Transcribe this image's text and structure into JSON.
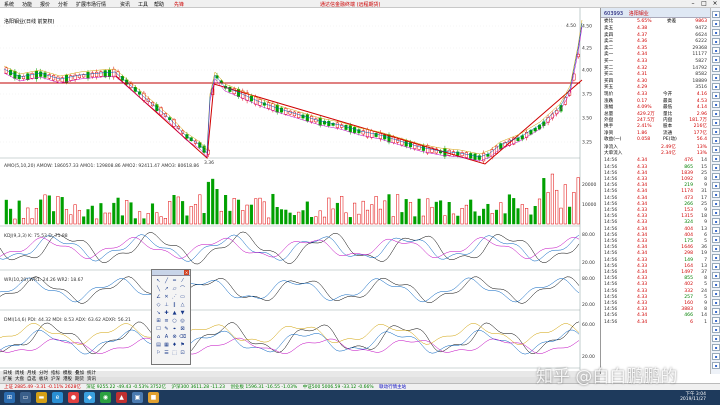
{
  "menu": {
    "items": [
      "系统",
      "功能",
      "报价",
      "分析",
      "扩展市场行情",
      "资讯",
      "工具",
      "帮助"
    ],
    "badge": "先锋",
    "center_title": "通达信金融终端 (远程期货)"
  },
  "stock": {
    "code": "603993",
    "name": "洛阳钼业",
    "chart_title": "洛阳钼业(日线 前复权)",
    "price_top": "4.50",
    "price_low": "3.36"
  },
  "indicators": {
    "amo": "AMO(5,10,20) AMOW: 186057.33  AMO1: 129808.86  AMO2: 92411.47  AMO3: 80618.86",
    "kdj": "KDJ(9,3,3) K: 75.53  D: 71.88",
    "wr": "WR(10,20) WR1: 24.26  WR2: 18.67",
    "dmi": "DMI(14,6) PDI: 44.32  MDI: 8.53  ADX: 63.62  ADXR: 56.21"
  },
  "quote_panel": {
    "header_code": "603993",
    "header_name": "洛阳钼业",
    "weibi": {
      "label": "委比",
      "value": "5.65%",
      "label2": "委差",
      "value2": "9863"
    },
    "asks": [
      {
        "label": "卖五",
        "price": "4.38",
        "vol": "9472"
      },
      {
        "label": "卖四",
        "price": "4.37",
        "vol": "6624"
      },
      {
        "label": "卖三",
        "price": "4.36",
        "vol": "6222"
      },
      {
        "label": "卖二",
        "price": "4.35",
        "vol": "29368"
      },
      {
        "label": "卖一",
        "price": "4.34",
        "vol": "11177"
      }
    ],
    "bids": [
      {
        "label": "买一",
        "price": "4.33",
        "vol": "5827"
      },
      {
        "label": "买二",
        "price": "4.32",
        "vol": "14792"
      },
      {
        "label": "买三",
        "price": "4.31",
        "vol": "8582"
      },
      {
        "label": "买四",
        "price": "4.30",
        "vol": "18889"
      },
      {
        "label": "买五",
        "price": "4.29",
        "vol": "3516"
      }
    ],
    "stats": [
      {
        "l": "现价",
        "v": "4.33",
        "l2": "今开",
        "v2": "4.16"
      },
      {
        "l": "涨跌",
        "v": "0.17",
        "l2": "最高",
        "v2": "4.53"
      },
      {
        "l": "涨幅",
        "v": "4.09%",
        "l2": "最低",
        "v2": "4.14"
      },
      {
        "l": "总量",
        "v": "429.2万",
        "l2": "量比",
        "v2": "2.96"
      },
      {
        "l": "外盘",
        "v": "247.5万",
        "l2": "内盘",
        "v2": "181.7万"
      },
      {
        "l": "换手",
        "v": "2.41%",
        "l2": "股本",
        "v2": "216亿"
      },
      {
        "l": "净资",
        "v": "1.86",
        "l2": "流通",
        "v2": "177亿"
      },
      {
        "l": "收益(一)",
        "v": "0.058",
        "l2": "PE(动)",
        "v2": "56.4"
      }
    ],
    "inflow": [
      {
        "l": "净流入",
        "v": "2.49亿",
        "pct": "13%"
      },
      {
        "l": "大单流入",
        "v": "2.34亿",
        "pct": "13%"
      }
    ],
    "ticks": [
      {
        "t": "14:56",
        "p": "4.34",
        "v": "476",
        "n": "14"
      },
      {
        "t": "14:56",
        "p": "4.33",
        "v": "865",
        "n": "15"
      },
      {
        "t": "14:56",
        "p": "4.34",
        "v": "1839",
        "n": "25"
      },
      {
        "t": "14:56",
        "p": "4.33",
        "v": "1092",
        "n": "8"
      },
      {
        "t": "14:56",
        "p": "4.34",
        "v": "219",
        "n": "9"
      },
      {
        "t": "14:56",
        "p": "4.34",
        "v": "1174",
        "n": "31"
      },
      {
        "t": "14:56",
        "p": "4.34",
        "v": "473",
        "n": "17"
      },
      {
        "t": "14:56",
        "p": "4.34",
        "v": "266",
        "n": "25"
      },
      {
        "t": "14:56",
        "p": "4.33",
        "v": "153",
        "n": "9"
      },
      {
        "t": "14:56",
        "p": "4.33",
        "v": "1315",
        "n": "18"
      },
      {
        "t": "14:56",
        "p": "4.33",
        "v": "324",
        "n": "9"
      },
      {
        "t": "14:56",
        "p": "4.34",
        "v": "404",
        "n": "13"
      },
      {
        "t": "14:56",
        "p": "4.34",
        "v": "404",
        "n": "6"
      },
      {
        "t": "14:56",
        "p": "4.33",
        "v": "175",
        "n": "5"
      },
      {
        "t": "14:56",
        "p": "4.34",
        "v": "1646",
        "n": "36"
      },
      {
        "t": "14:56",
        "p": "4.34",
        "v": "298",
        "n": "19"
      },
      {
        "t": "14:56",
        "p": "4.33",
        "v": "149",
        "n": "7"
      },
      {
        "t": "14:56",
        "p": "4.33",
        "v": "164",
        "n": "13"
      },
      {
        "t": "14:56",
        "p": "4.34",
        "v": "1497",
        "n": "37"
      },
      {
        "t": "14:56",
        "p": "4.33",
        "v": "855",
        "n": "8"
      },
      {
        "t": "14:56",
        "p": "4.33",
        "v": "402",
        "n": "5"
      },
      {
        "t": "14:56",
        "p": "4.33",
        "v": "332",
        "n": "24"
      },
      {
        "t": "14:56",
        "p": "4.33",
        "v": "257",
        "n": "5"
      },
      {
        "t": "14:56",
        "p": "4.33",
        "v": "160",
        "n": "9"
      },
      {
        "t": "14:56",
        "p": "4.33",
        "v": "3883",
        "n": "8"
      },
      {
        "t": "14:56",
        "p": "4.34",
        "v": "466",
        "n": "14"
      },
      {
        "t": "14:56",
        "p": "4.34",
        "v": "6",
        "n": "1"
      }
    ]
  },
  "tabs_row": [
    "日线",
    "周线",
    "月线",
    "分时",
    "指标",
    "模板",
    "叠加",
    "统计"
  ],
  "tabs_row2": [
    "扩展",
    "大盘",
    "自选",
    "板块",
    "沪深",
    "港股",
    "期货",
    "资讯"
  ],
  "statusbar": {
    "sh": "上证 2885.49  -3.31  -0.11%  2628亿",
    "sz": "深证 9255.22  -49.43  -0.53%  3752亿",
    "hs300": "沪深300 3611.28  -11.23",
    "cy": "创业板 1596.31  -16.55  -1.03%",
    "zz": "中证500 5006.59  -33.12  -0.66%",
    "extra": "联动行情主站"
  },
  "taskbar": {
    "clock_time": "下午 3:04",
    "clock_date": "2019/11/27"
  },
  "watermark": "知乎 @白白鹏鹏的"
}
